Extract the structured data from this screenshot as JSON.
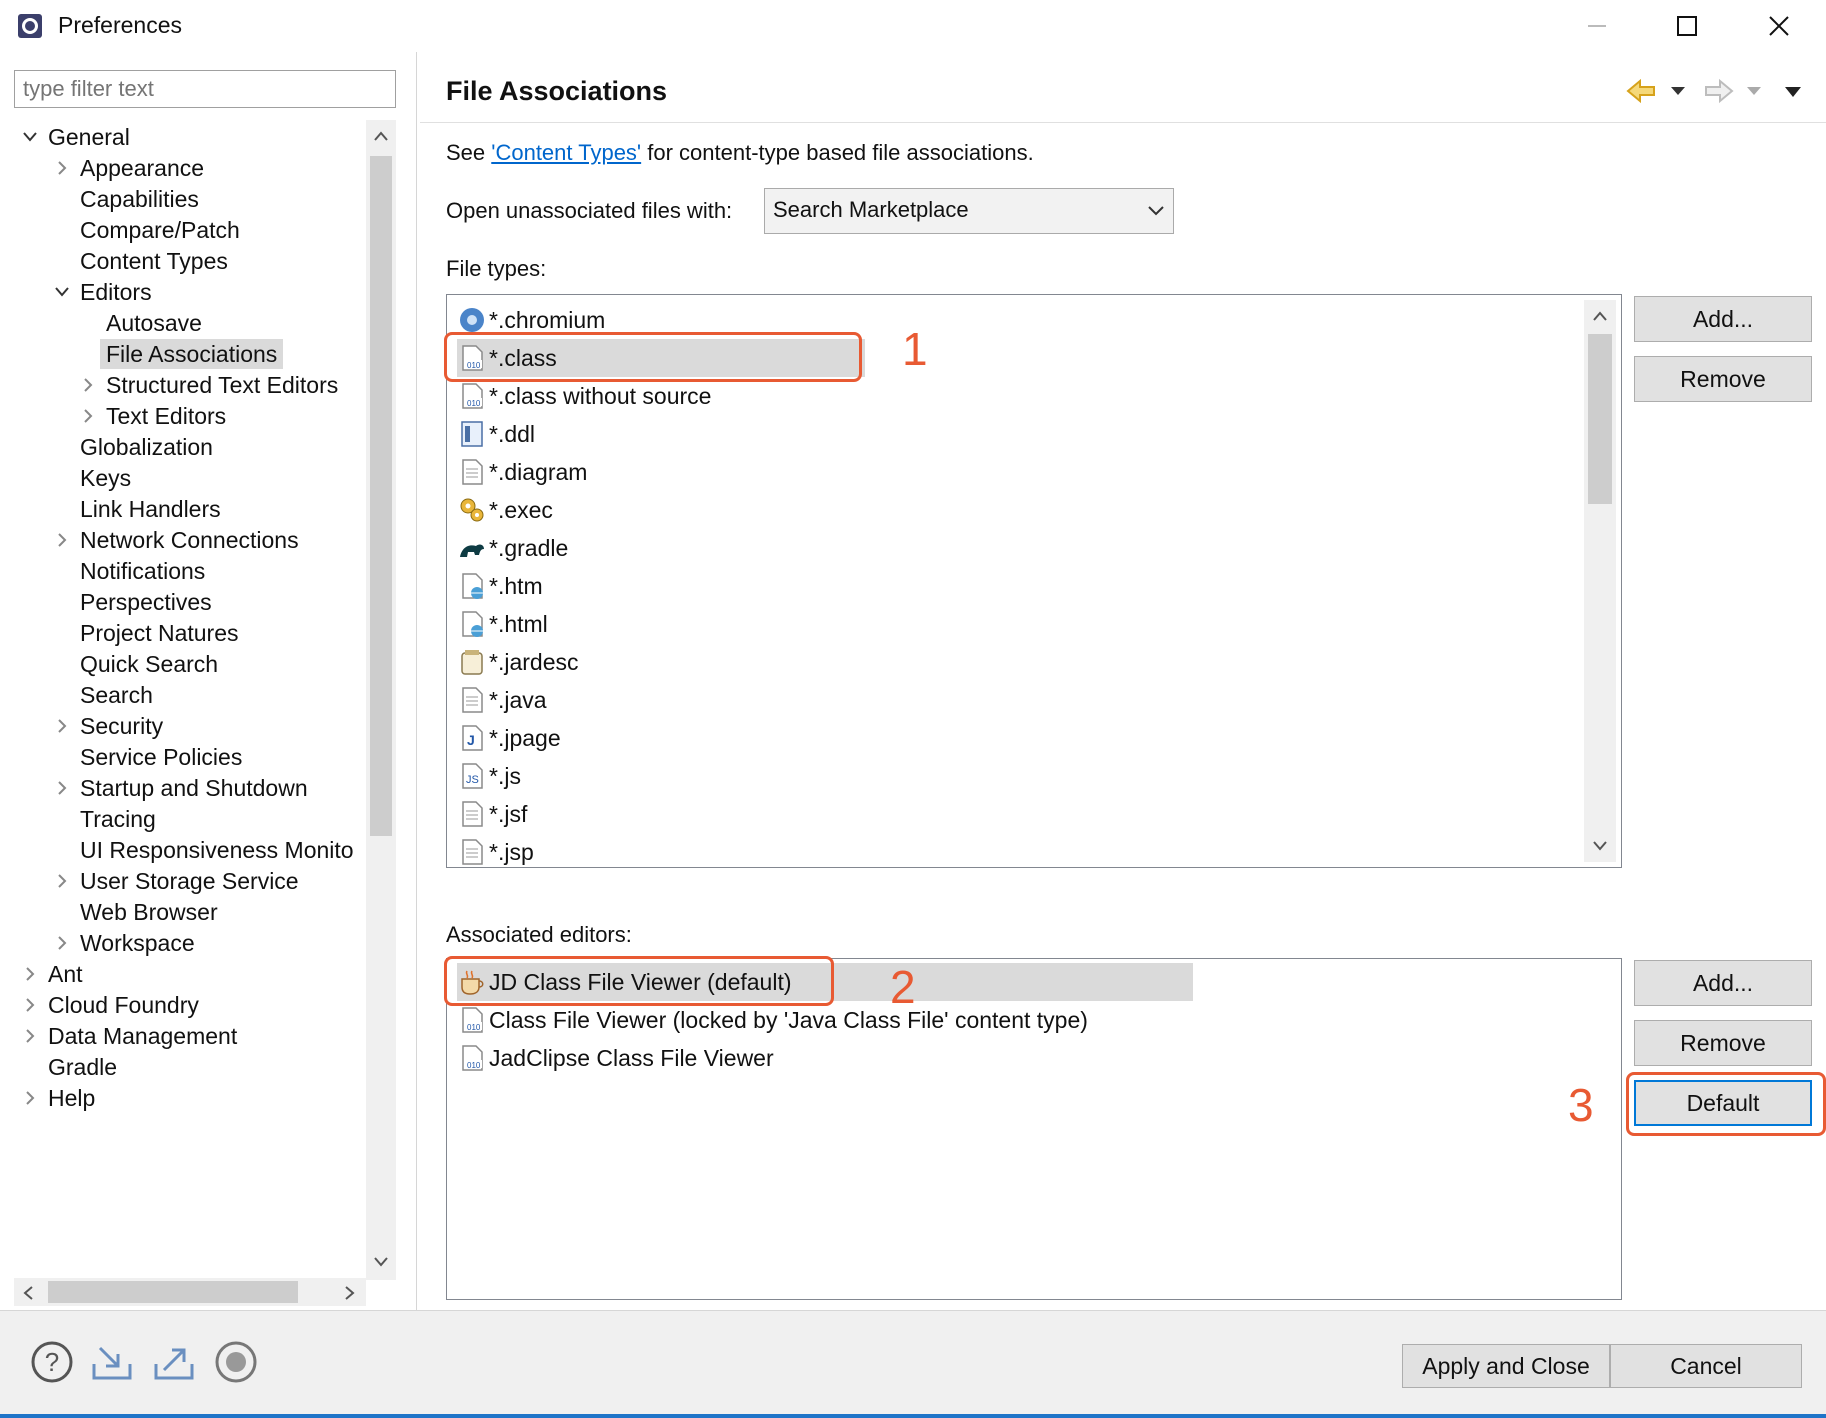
{
  "window": {
    "title": "Preferences"
  },
  "sidebar": {
    "filter_placeholder": "type filter text",
    "tree": [
      {
        "label": "General",
        "depth": 0,
        "expanded": true
      },
      {
        "label": "Appearance",
        "depth": 1,
        "collapsed": true
      },
      {
        "label": "Capabilities",
        "depth": 1
      },
      {
        "label": "Compare/Patch",
        "depth": 1
      },
      {
        "label": "Content Types",
        "depth": 1
      },
      {
        "label": "Editors",
        "depth": 1,
        "expanded": true
      },
      {
        "label": "Autosave",
        "depth": 2
      },
      {
        "label": "File Associations",
        "depth": 2,
        "selected": true
      },
      {
        "label": "Structured Text Editors",
        "depth": 2,
        "collapsed": true
      },
      {
        "label": "Text Editors",
        "depth": 2,
        "collapsed": true
      },
      {
        "label": "Globalization",
        "depth": 1
      },
      {
        "label": "Keys",
        "depth": 1
      },
      {
        "label": "Link Handlers",
        "depth": 1
      },
      {
        "label": "Network Connections",
        "depth": 1,
        "collapsed": true
      },
      {
        "label": "Notifications",
        "depth": 1
      },
      {
        "label": "Perspectives",
        "depth": 1
      },
      {
        "label": "Project Natures",
        "depth": 1
      },
      {
        "label": "Quick Search",
        "depth": 1
      },
      {
        "label": "Search",
        "depth": 1
      },
      {
        "label": "Security",
        "depth": 1,
        "collapsed": true
      },
      {
        "label": "Service Policies",
        "depth": 1
      },
      {
        "label": "Startup and Shutdown",
        "depth": 1,
        "collapsed": true
      },
      {
        "label": "Tracing",
        "depth": 1
      },
      {
        "label": "UI Responsiveness Monito",
        "depth": 1
      },
      {
        "label": "User Storage Service",
        "depth": 1,
        "collapsed": true
      },
      {
        "label": "Web Browser",
        "depth": 1
      },
      {
        "label": "Workspace",
        "depth": 1,
        "collapsed": true
      },
      {
        "label": "Ant",
        "depth": 0,
        "collapsed": true
      },
      {
        "label": "Cloud Foundry",
        "depth": 0,
        "collapsed": true
      },
      {
        "label": "Data Management",
        "depth": 0,
        "collapsed": true
      },
      {
        "label": "Gradle",
        "depth": 0
      },
      {
        "label": "Help",
        "depth": 0,
        "collapsed": true
      }
    ]
  },
  "main": {
    "title": "File Associations",
    "see_prefix": "See ",
    "see_link": "'Content Types'",
    "see_suffix": " for content-type based file associations.",
    "open_label": "Open unassociated files with:",
    "open_value": "Search Marketplace",
    "file_types_label": "File types:",
    "file_types": [
      {
        "label": "*.chromium",
        "icon": "chromium-icon"
      },
      {
        "label": "*.class",
        "icon": "class-file-icon",
        "selected": true
      },
      {
        "label": "*.class without source",
        "icon": "class-file-icon"
      },
      {
        "label": "*.ddl",
        "icon": "ddl-icon"
      },
      {
        "label": "*.diagram",
        "icon": "text-file-icon"
      },
      {
        "label": "*.exec",
        "icon": "gears-icon"
      },
      {
        "label": "*.gradle",
        "icon": "gradle-icon"
      },
      {
        "label": "*.htm",
        "icon": "html-file-icon"
      },
      {
        "label": "*.html",
        "icon": "html-file-icon"
      },
      {
        "label": "*.jardesc",
        "icon": "jar-icon"
      },
      {
        "label": "*.java",
        "icon": "text-file-icon"
      },
      {
        "label": "*.jpage",
        "icon": "jpage-icon"
      },
      {
        "label": "*.js",
        "icon": "js-file-icon"
      },
      {
        "label": "*.jsf",
        "icon": "text-file-icon"
      },
      {
        "label": "*.jsp",
        "icon": "text-file-icon"
      }
    ],
    "file_types_buttons": {
      "add": "Add...",
      "remove": "Remove"
    },
    "assoc_label": "Associated editors:",
    "editors": [
      {
        "label": "JD Class File Viewer (default)",
        "icon": "coffee-cup-icon",
        "selected": true
      },
      {
        "label": "Class File Viewer (locked by 'Java Class File' content type)",
        "icon": "class-file-icon"
      },
      {
        "label": "JadClipse Class File Viewer",
        "icon": "class-file-icon"
      }
    ],
    "editor_buttons": {
      "add": "Add...",
      "remove": "Remove",
      "default": "Default"
    },
    "annotations": [
      "1",
      "2",
      "3"
    ]
  },
  "footer": {
    "apply_close": "Apply and Close",
    "cancel": "Cancel",
    "icons": [
      "help-icon",
      "import-icon",
      "export-icon",
      "record-icon"
    ]
  },
  "colors": {
    "accent": "#0078d7",
    "annotation": "#e85a33",
    "selection": "#dadada",
    "link": "#0066cc"
  }
}
